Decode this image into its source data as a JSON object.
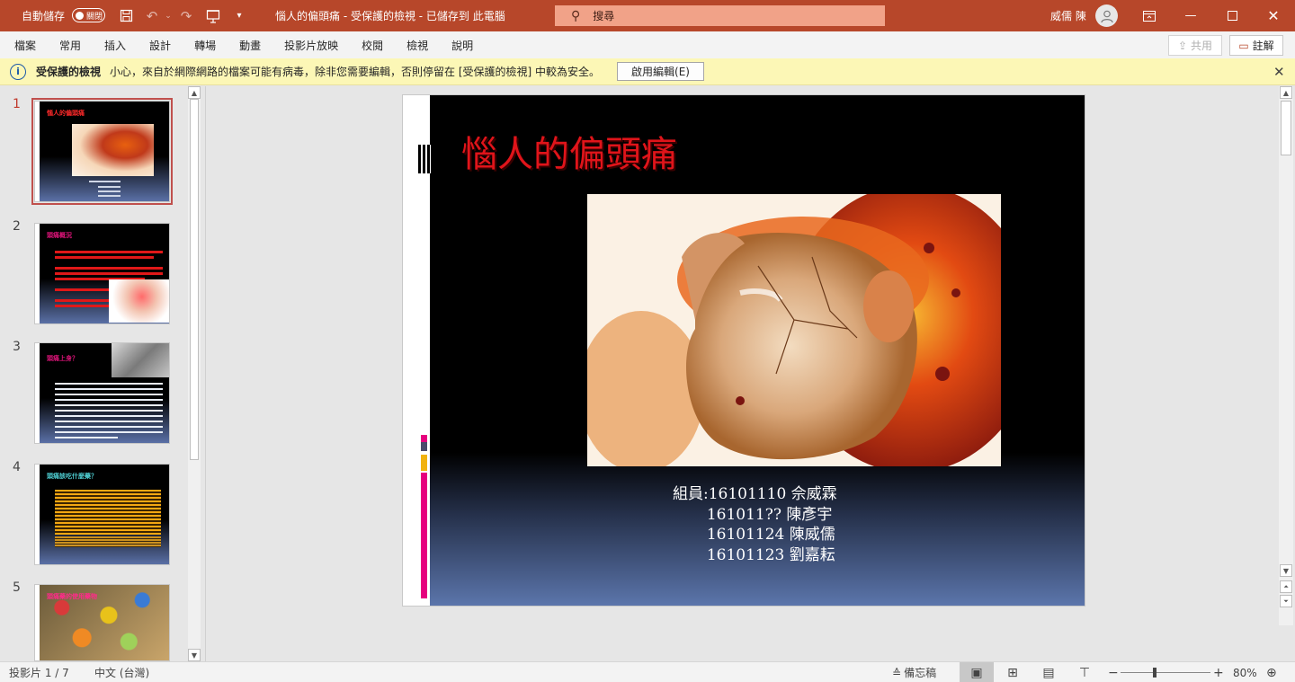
{
  "titlebar": {
    "autosave_label": "自動儲存",
    "autosave_state": "關閉",
    "doc_title": "惱人的偏頭痛  -  受保護的檢視  -  已儲存到 此電腦",
    "search_placeholder": "搜尋",
    "user_name": "威儒 陳",
    "accent_color": "#b7472a"
  },
  "ribbon": {
    "tabs": [
      "檔案",
      "常用",
      "插入",
      "設計",
      "轉場",
      "動畫",
      "投影片放映",
      "校閱",
      "檢視",
      "說明"
    ],
    "share_label": "共用",
    "comments_label": "註解"
  },
  "protected_view": {
    "title": "受保護的檢視",
    "message": "小心，來自於網際網路的檔案可能有病毒，除非您需要編輯，否則停留在 [受保護的檢視] 中較為安全。",
    "enable_button": "啟用編輯(E)"
  },
  "thumbnails": [
    {
      "number": "1",
      "title": "惱人的偏頭痛",
      "active": true
    },
    {
      "number": "2",
      "title": "頭痛概況",
      "active": false
    },
    {
      "number": "3",
      "title": "頭痛上身？",
      "active": false
    },
    {
      "number": "4",
      "title": "頭痛該吃什麼藥？",
      "active": false
    },
    {
      "number": "5",
      "title": "頭痛藥的使用藥物",
      "active": false
    }
  ],
  "slide": {
    "title": "惱人的偏頭痛",
    "members": [
      "組員:16101110 佘威霖",
      "       161011?? 陳彥宇",
      "       16101124 陳威儒",
      "       16101123 劉嘉耘"
    ]
  },
  "statusbar": {
    "slide_position": "投影片 1 / 7",
    "language": "中文 (台灣)",
    "notes_label": "備忘稿",
    "zoom_level": "80%",
    "zoom_fraction": 0.8
  }
}
